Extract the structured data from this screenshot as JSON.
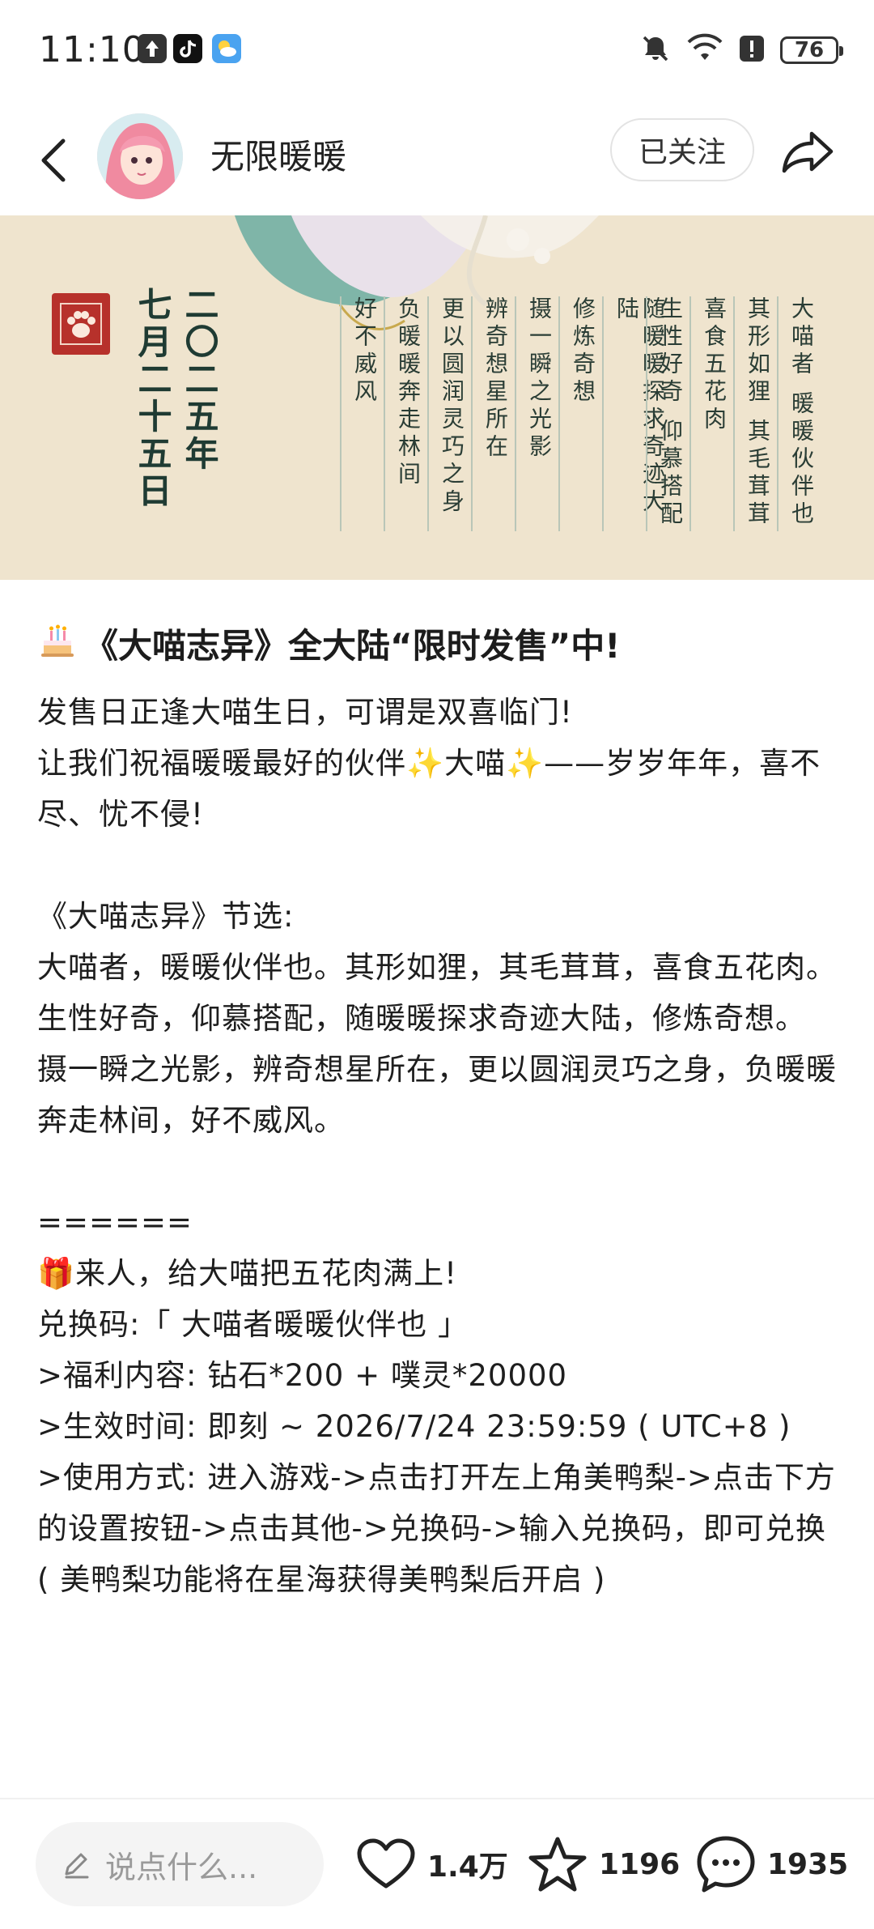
{
  "status_bar": {
    "time": "11:10",
    "battery": "76"
  },
  "header": {
    "author_name": "无限暖暖",
    "follow_label": "已关注"
  },
  "banner": {
    "date": [
      "二〇二五年",
      "七月二十五日"
    ],
    "poem_columns": [
      "大喵者 暖暖伙伴也",
      "其形如狸 其毛茸茸",
      "喜食五花肉",
      "生性好奇 仰慕搭配",
      "随暖暖探求奇迹大陆",
      "修炼奇想",
      "摄一瞬之光影",
      "辨奇想星所在",
      "更以圆润灵巧之身",
      "负暖暖奔走林间",
      "好不威风"
    ]
  },
  "post": {
    "title": "《大喵志异》全大陆“限时发售”中!",
    "paragraphs": [
      "发售日正逢大喵生日，可谓是双喜临门!",
      "让我们祝福暖暖最好的伙伴✨大喵✨——岁岁年年，喜不尽、忧不侵!",
      "",
      "《大喵志异》节选:",
      "大喵者，暖暖伙伴也。其形如狸，其毛茸茸，喜食五花肉。",
      "生性好奇，仰慕搭配，随暖暖探求奇迹大陆，修炼奇想。",
      "摄一瞬之光影，辨奇想星所在，更以圆润灵巧之身，负暖暖奔走林间，好不威风。",
      "",
      "======",
      "🎁来人，给大喵把五花肉满上!",
      "兑换码:「 大喵者暖暖伙伴也 」",
      ">福利内容: 钻石*200 + 噗灵*20000",
      ">生效时间: 即刻 ~ 2026/7/24 23:59:59 ( UTC+8 )",
      ">使用方式: 进入游戏->点击打开左上角美鸭梨->点击下方的设置按钮->点击其他->兑换码->输入兑换码，即可兑换 ( 美鸭梨功能将在星海获得美鸭梨后开启 )"
    ]
  },
  "bottom_bar": {
    "comment_placeholder": "说点什么...",
    "likes": "1.4万",
    "favorites": "1196",
    "comments": "1935"
  }
}
